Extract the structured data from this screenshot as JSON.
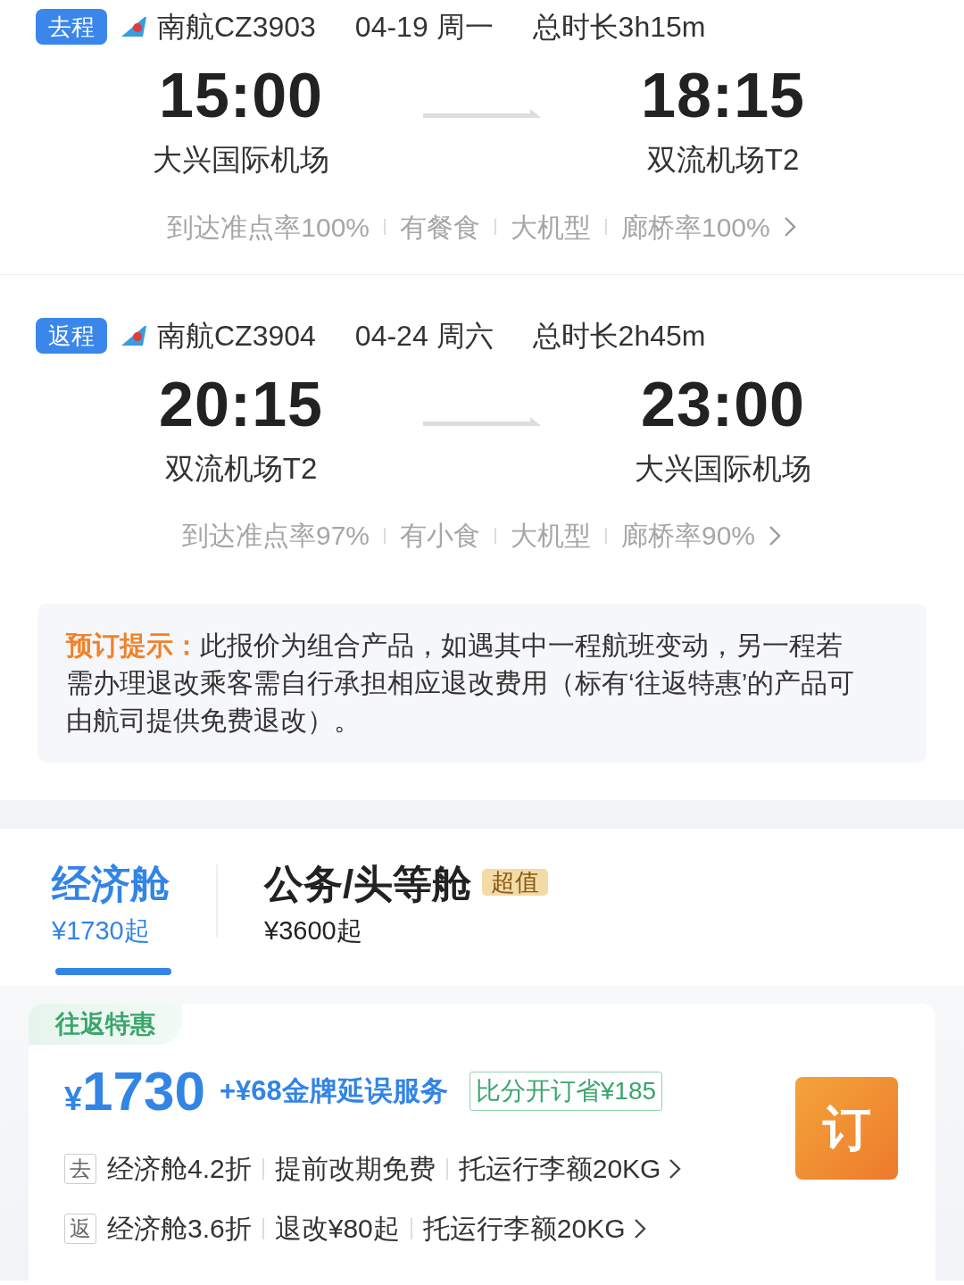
{
  "flights": [
    {
      "tag": "去程",
      "airline": "南航CZ3903",
      "date": "04-19 周一",
      "duration": "总时长3h15m",
      "dep_time": "15:00",
      "dep_airport": "大兴国际机场",
      "arr_time": "18:15",
      "arr_airport": "双流机场T2",
      "features": [
        "到达准点率100%",
        "有餐食",
        "大机型",
        "廊桥率100%"
      ]
    },
    {
      "tag": "返程",
      "airline": "南航CZ3904",
      "date": "04-24 周六",
      "duration": "总时长2h45m",
      "dep_time": "20:15",
      "dep_airport": "双流机场T2",
      "arr_time": "23:00",
      "arr_airport": "大兴国际机场",
      "features": [
        "到达准点率97%",
        "有小食",
        "大机型",
        "廊桥率90%"
      ]
    }
  ],
  "notice": {
    "label": "预订提示：",
    "text": "此报价为组合产品，如遇其中一程航班变动，另一程若需办理退改乘客需自行承担相应退改费用（标有‘往返特惠’的产品可由航司提供免费退改）。"
  },
  "cabin_tabs": [
    {
      "name": "经济舱",
      "price": "¥1730起",
      "selected": true
    },
    {
      "name": "公务/头等舱",
      "price": "¥3600起",
      "badge": "超值",
      "selected": false
    }
  ],
  "fare": {
    "tag": "往返特惠",
    "currency": "¥",
    "price": "1730",
    "addon": "+¥68金牌延误服务",
    "saving": "比分开订省¥185",
    "book_button": "订",
    "legs": [
      {
        "tag": "去",
        "items": [
          "经济舱4.2折",
          "提前改期免费",
          "托运行李额20KG"
        ]
      },
      {
        "tag": "返",
        "items": [
          "经济舱3.6折",
          "退改¥80起",
          "托运行李额20KG"
        ]
      }
    ]
  }
}
